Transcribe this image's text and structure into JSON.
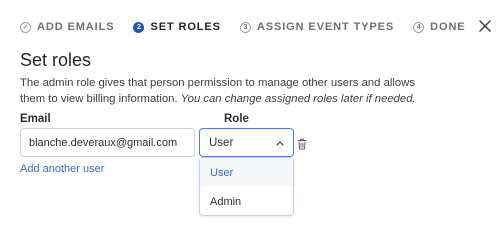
{
  "stepper": {
    "steps": [
      {
        "number": "✓",
        "label": "ADD EMAILS",
        "state": "done"
      },
      {
        "number": "2",
        "label": "SET ROLES",
        "state": "active"
      },
      {
        "number": "3",
        "label": "ASSIGN EVENT TYPES",
        "state": "pending"
      },
      {
        "number": "4",
        "label": "DONE",
        "state": "pending"
      }
    ]
  },
  "page": {
    "title": "Set roles",
    "description_main": "The admin role gives that person permission to manage other users and allows them to view billing information. ",
    "description_italic": "You can change assigned roles later if needed."
  },
  "form": {
    "email_label": "Email",
    "role_label": "Role",
    "email_value": "blanche.deveraux@gmail.com",
    "role_value": "User",
    "add_user_label": "Add another user"
  },
  "dropdown": {
    "options": [
      "User",
      "Admin"
    ],
    "selected": "User"
  },
  "icons": {
    "close": "close-icon",
    "trash": "trash-icon",
    "chevron": "chevron-up-icon"
  },
  "colors": {
    "accent": "#1a56c4",
    "link": "#2f6fde",
    "focus_border": "#4a7ff0"
  }
}
